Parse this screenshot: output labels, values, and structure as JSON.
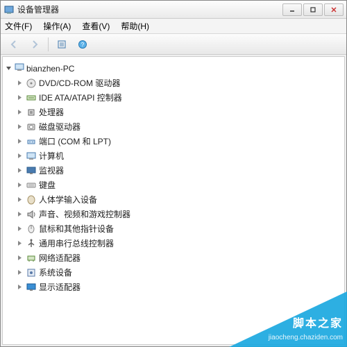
{
  "window": {
    "title": "设备管理器"
  },
  "menu": {
    "file": "文件(F)",
    "action": "操作(A)",
    "view": "查看(V)",
    "help": "帮助(H)"
  },
  "tree": {
    "root": "bianzhen-PC",
    "items": [
      {
        "label": "DVD/CD-ROM 驱动器",
        "icon": "disc"
      },
      {
        "label": "IDE ATA/ATAPI 控制器",
        "icon": "ide"
      },
      {
        "label": "处理器",
        "icon": "cpu"
      },
      {
        "label": "磁盘驱动器",
        "icon": "hdd"
      },
      {
        "label": "端口 (COM 和 LPT)",
        "icon": "port"
      },
      {
        "label": "计算机",
        "icon": "pc"
      },
      {
        "label": "监视器",
        "icon": "monitor"
      },
      {
        "label": "键盘",
        "icon": "keyboard"
      },
      {
        "label": "人体学输入设备",
        "icon": "hid"
      },
      {
        "label": "声音、视频和游戏控制器",
        "icon": "sound"
      },
      {
        "label": "鼠标和其他指针设备",
        "icon": "mouse"
      },
      {
        "label": "通用串行总线控制器",
        "icon": "usb"
      },
      {
        "label": "网络适配器",
        "icon": "net"
      },
      {
        "label": "系统设备",
        "icon": "sys"
      },
      {
        "label": "显示适配器",
        "icon": "display"
      }
    ]
  },
  "watermark": {
    "brand": "脚本之家",
    "url": "jiaocheng.chaziden.com"
  }
}
